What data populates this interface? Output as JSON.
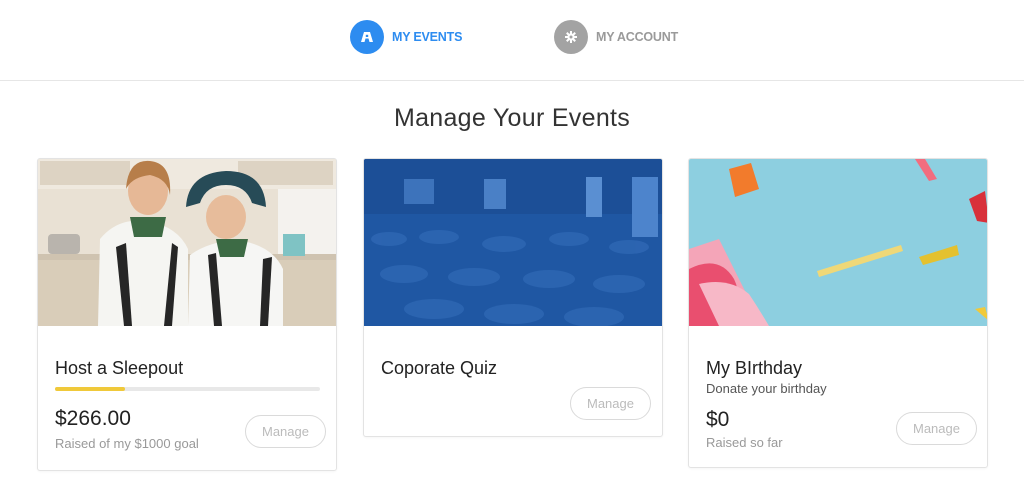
{
  "nav": {
    "events": {
      "label": "MY EVENTS",
      "icon": "events-icon",
      "color": "#2d8cf0"
    },
    "account": {
      "label": "MY ACCOUNT",
      "icon": "gear-icon",
      "color": "#a3a3a3"
    }
  },
  "page": {
    "title": "Manage Your Events"
  },
  "cards": [
    {
      "title": "Host a Sleepout",
      "image": "children-in-school-uniforms-photo",
      "progress": 0.266,
      "progress_color": "#f0c93a",
      "amount": "$266.00",
      "amount_note": "Raised of my $1000 goal",
      "button": "Manage"
    },
    {
      "title": "Coporate Quiz",
      "image": "blue-tinted-banquet-hall-photo",
      "button": "Manage"
    },
    {
      "title": "My BIrthday",
      "subtitle": "Donate your birthday",
      "image": "birthday-gift-and-candle-photo",
      "amount": "$0",
      "amount_note": "Raised so far",
      "button": "Manage"
    }
  ]
}
